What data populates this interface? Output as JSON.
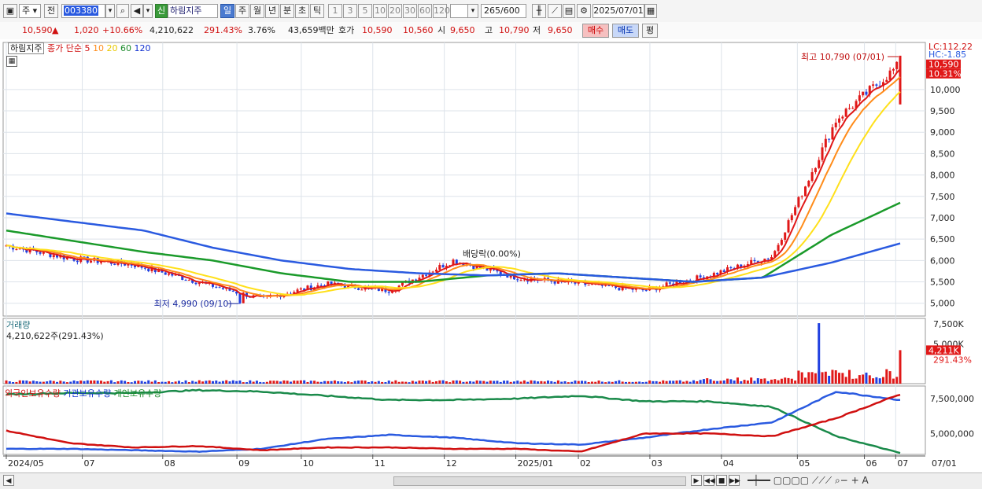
{
  "toolbar": {
    "type_label": "주",
    "all_label": "전",
    "code": "003380",
    "name": "하림지주",
    "new_label": "신",
    "period_tabs": [
      "일",
      "주",
      "월",
      "년",
      "분",
      "초",
      "틱"
    ],
    "active_period": "일",
    "interval_tabs": [
      "1",
      "3",
      "5",
      "10",
      "20",
      "30",
      "60",
      "120"
    ],
    "count": "265",
    "count_total": "/600",
    "date": "2025/07/01"
  },
  "quote": {
    "price": "10,590",
    "arrow": "▲",
    "change": "1,020",
    "change_pct": "+10.66%",
    "volume": "4,210,622",
    "volume_ratio": "291.43%",
    "turnover": "3.76%",
    "amount": "43,659백만",
    "ask_label": "호가",
    "ask": "10,590",
    "bid": "10,560",
    "open_label": "시",
    "open": "9,650",
    "high_label": "고",
    "high": "10,790",
    "low_label": "저",
    "low": "9,650",
    "buy_label": "매수",
    "sell_label": "매도",
    "eval_label": "평"
  },
  "chart_data": [
    {
      "type": "candlestick",
      "title": "하림지주",
      "legend": {
        "close_label": "종가 단순",
        "ma_periods": [
          "5",
          "10",
          "20",
          "60",
          "120"
        ],
        "ma_colors": [
          "#e01818",
          "#ff8c1a",
          "#ffe01a",
          "#1a9a2a",
          "#2a5ae0"
        ]
      },
      "ylim": [
        4700,
        11100
      ],
      "yticks": [
        5000,
        5500,
        6000,
        6500,
        7000,
        7500,
        8000,
        8500,
        9000,
        9500,
        10000
      ],
      "ytick_labels": [
        "5,000",
        "5,500",
        "6,000",
        "6,500",
        "7,000",
        "7,500",
        "8,000",
        "8,500",
        "9,000",
        "9,500",
        "10,000"
      ],
      "x_labels": [
        "2024/05",
        "07",
        "08",
        "09",
        "10",
        "11",
        "12",
        "2025/01",
        "02",
        "03",
        "04",
        "05",
        "06",
        "07",
        "07/01"
      ],
      "lc_label": "LC:112.22",
      "hc_label": "HC:-1.85",
      "last_price_tag": "10,590",
      "last_pct_tag": "10.31%",
      "annotations": {
        "high": "최고 10,790 (07/01)",
        "low": "최저 4,990 (09/10)",
        "dividend": "배당락(0.00%)"
      },
      "close_path": [
        {
          "m": "2024/05",
          "v": 6350
        },
        {
          "m": "2024/06",
          "v": 6050
        },
        {
          "m": "2024/07",
          "v": 5900
        },
        {
          "m": "2024/08",
          "v": 5500
        },
        {
          "m": "2024/09",
          "v": 5100
        },
        {
          "m": "2024/10",
          "v": 5450
        },
        {
          "m": "2024/11",
          "v": 5300
        },
        {
          "m": "2024/12",
          "v": 6000
        },
        {
          "m": "2025/01",
          "v": 5600
        },
        {
          "m": "2025/02",
          "v": 5450
        },
        {
          "m": "2025/03",
          "v": 5300
        },
        {
          "m": "2025/04",
          "v": 5650
        },
        {
          "m": "2025/05",
          "v": 6100
        },
        {
          "m": "2025/06",
          "v": 9300
        },
        {
          "m": "2025/07/01",
          "v": 10590
        }
      ],
      "ma60_path": [
        6700,
        6450,
        6200,
        6000,
        5700,
        5500,
        5500,
        5650,
        5700,
        5600,
        5500,
        5600,
        6600,
        7350
      ],
      "ma120_path": [
        7100,
        6900,
        6700,
        6300,
        6000,
        5800,
        5700,
        5650,
        5700,
        5600,
        5500,
        5600,
        5950,
        6400
      ]
    },
    {
      "type": "bar",
      "title": "거래량",
      "current_label": "4,210,622주(291.43%)",
      "yticks": [
        "7,500K",
        "5,000K"
      ],
      "last_tag": "4,211K",
      "last_pct": "291.43%",
      "spike_value": 7600000,
      "last_value": 4210622
    },
    {
      "type": "line",
      "series_names": [
        "외국인보유수량",
        "기관보유수량",
        "개인보유수량"
      ],
      "yticks": [
        "7,500,000",
        "5,000,000"
      ],
      "series_colors": [
        "#d01010",
        "#2a5ae0",
        "#1a8a4a"
      ]
    }
  ]
}
